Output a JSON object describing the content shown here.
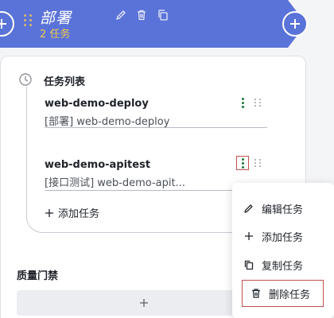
{
  "stage": {
    "title": "部署",
    "count": "2 任务"
  },
  "job": {
    "title": "任务列表"
  },
  "tasks": [
    {
      "name": "web-demo-deploy",
      "subtitle": "[部署] web-demo-deploy"
    },
    {
      "name": "web-demo-apitest",
      "subtitle": "[接口测试] web-demo-apit..."
    }
  ],
  "add_task_label": "添加任务",
  "quality_gate": {
    "title": "质量门禁"
  },
  "menu": {
    "edit": "编辑任务",
    "add": "添加任务",
    "copy": "复制任务",
    "delete": "删除任务"
  },
  "colors": {
    "banner": "#5a73d8",
    "count": "#f2c94c",
    "kebab": "#1a7a3a",
    "highlight": "#c0504d"
  }
}
